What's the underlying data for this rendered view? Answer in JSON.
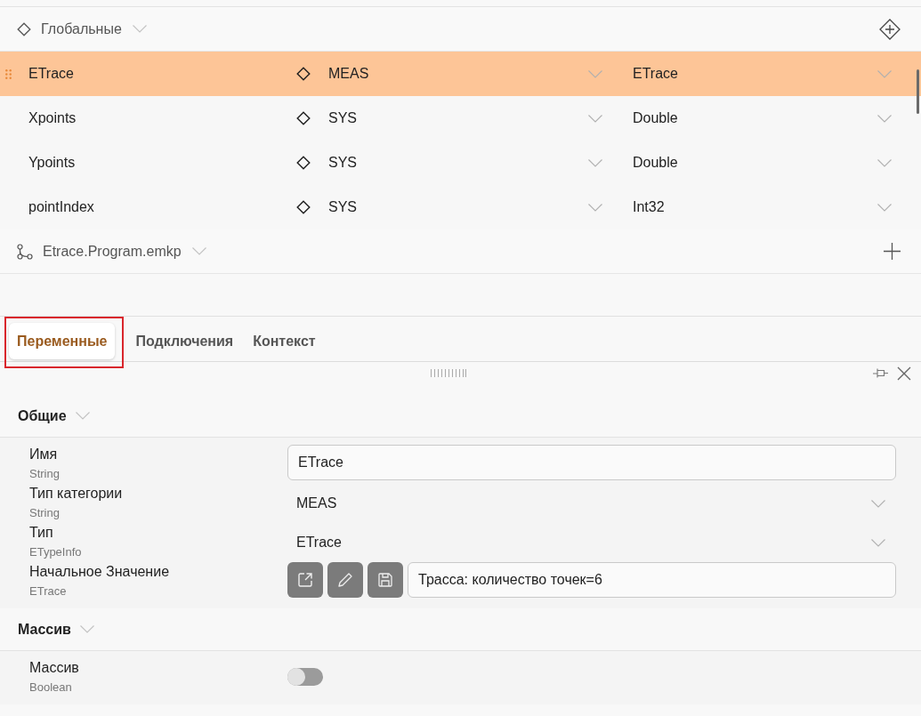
{
  "groups": [
    {
      "kind": "global",
      "title": "Глобальные",
      "rows": [
        {
          "name": "ETrace",
          "category": "MEAS",
          "type": "ETrace",
          "selected": true
        },
        {
          "name": "Xpoints",
          "category": "SYS",
          "type": "Double",
          "selected": false
        },
        {
          "name": "Ypoints",
          "category": "SYS",
          "type": "Double",
          "selected": false
        },
        {
          "name": "pointIndex",
          "category": "SYS",
          "type": "Int32",
          "selected": false
        }
      ]
    },
    {
      "kind": "program",
      "title": "Etrace.Program.emkp"
    }
  ],
  "tabs": [
    {
      "label": "Переменные",
      "selected": true,
      "highlighted": true
    },
    {
      "label": "Подключения",
      "selected": false,
      "highlighted": false
    },
    {
      "label": "Контекст",
      "selected": false,
      "highlighted": false
    }
  ],
  "sections": [
    {
      "title": "Общие",
      "properties": [
        {
          "label": "Имя",
          "type": "String",
          "kind": "text",
          "value": "ETrace"
        },
        {
          "label": "Тип категории",
          "type": "String",
          "kind": "dropdown",
          "value": "MEAS"
        },
        {
          "label": "Тип",
          "type": "ETypeInfo",
          "kind": "dropdown",
          "value": "ETrace"
        },
        {
          "label": "Начальное Значение",
          "type": "ETrace",
          "kind": "object",
          "value": "Трасса: количество точек=6"
        }
      ]
    },
    {
      "title": "Массив",
      "properties": [
        {
          "label": "Массив",
          "type": "Boolean",
          "kind": "toggle",
          "on": false
        }
      ]
    }
  ]
}
